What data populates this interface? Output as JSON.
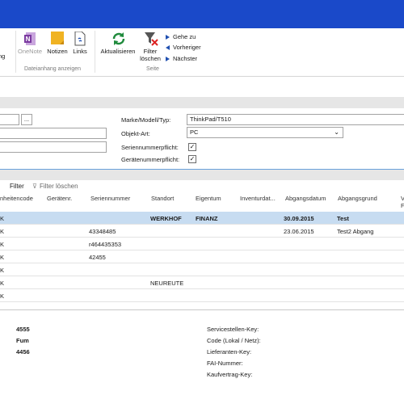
{
  "ribbon": {
    "left_cut_label": "ng",
    "onenote": "OneNote",
    "notizen": "Notizen",
    "links": "Links",
    "group_dateianhang": "Dateianhang anzeigen",
    "aktualisieren": "Aktualisieren",
    "filter_line1": "Filter",
    "filter_line2": "löschen",
    "gehe_zu": "Gehe zu",
    "vorheriger": "Vorheriger",
    "naechster": "Nächster",
    "group_seite": "Seite",
    "colors": {
      "onenote": "#7b3aa0",
      "notizen": "#f0b323",
      "refresh": "#1f8a3c",
      "nav": "#1f4fb0"
    }
  },
  "form": {
    "browse_button": "...",
    "marke_label": "Marke/Modell/Typ:",
    "marke_value": "ThinkPad/T510",
    "objekt_label": "Objekt-Art:",
    "objekt_value": "PC",
    "seriennummer_label": "Seriennummerpflicht:",
    "geraete_label": "Gerätenummerpflicht:",
    "check_mark": "✓"
  },
  "filterbar": {
    "filter": "Filter",
    "filter_loeschen": "Filter löschen"
  },
  "grid": {
    "headers": [
      "nheitencode",
      "Gerätenr.",
      "Seriennummer",
      "Standort",
      "Eigentum",
      "Inventurdat...",
      "Abgangsdatum",
      "Abgangsgrund",
      "V"
    ],
    "header_cut2": "F",
    "rows": [
      {
        "c0": "K",
        "serial": "",
        "standort": "WERKHOF",
        "eigentum": "FINANZ",
        "datum": "30.09.2015",
        "grund": "Test"
      },
      {
        "c0": "K",
        "serial": "43348485",
        "standort": "",
        "eigentum": "",
        "datum": "23.06.2015",
        "grund": "Test2 Abgang"
      },
      {
        "c0": "K",
        "serial": "r464435353",
        "standort": "",
        "eigentum": "",
        "datum": "",
        "grund": ""
      },
      {
        "c0": "K",
        "serial": "42455",
        "standort": "",
        "eigentum": "",
        "datum": "",
        "grund": ""
      },
      {
        "c0": "K",
        "serial": "",
        "standort": "",
        "eigentum": "",
        "datum": "",
        "grund": ""
      },
      {
        "c0": "K",
        "serial": "",
        "standort": "NEUREUTE",
        "eigentum": "",
        "datum": "",
        "grund": ""
      },
      {
        "c0": "K",
        "serial": "",
        "standort": "",
        "eigentum": "",
        "datum": "",
        "grund": ""
      }
    ]
  },
  "bottom": {
    "values": [
      "4555",
      "Fum",
      "4456"
    ],
    "labels": [
      "Servicestellen-Key:",
      "Code (Lokal / Netz):",
      "Lieferanten-Key:",
      "FAI-Nummer:",
      "Kaufvertrag-Key:"
    ]
  }
}
